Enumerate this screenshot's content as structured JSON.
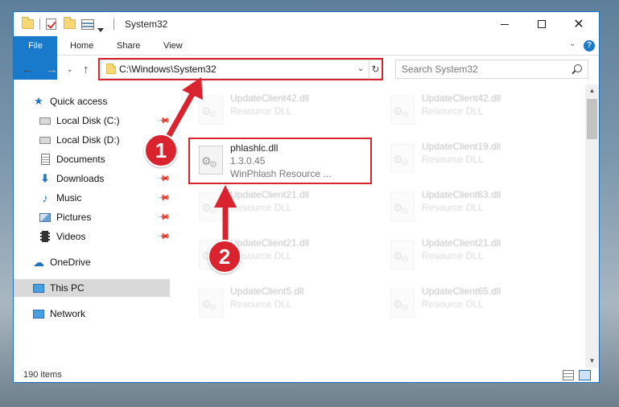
{
  "window": {
    "title": "System32"
  },
  "ribbon": {
    "tabs": [
      "File",
      "Home",
      "Share",
      "View"
    ]
  },
  "navigation": {
    "address_path": "C:\\Windows\\System32",
    "search_placeholder": "Search System32"
  },
  "sidebar": {
    "items": [
      {
        "label": "Quick access",
        "icon": "star-icon",
        "pinned": false
      },
      {
        "label": "Local Disk (C:)",
        "icon": "disk-icon",
        "pinned": true
      },
      {
        "label": "Local Disk (D:)",
        "icon": "disk-icon",
        "pinned": false
      },
      {
        "label": "Documents",
        "icon": "documents-icon",
        "pinned": false
      },
      {
        "label": "Downloads",
        "icon": "downloads-icon",
        "pinned": true
      },
      {
        "label": "Music",
        "icon": "music-icon",
        "pinned": true
      },
      {
        "label": "Pictures",
        "icon": "pictures-icon",
        "pinned": true
      },
      {
        "label": "Videos",
        "icon": "videos-icon",
        "pinned": true
      },
      {
        "label": "OneDrive",
        "icon": "onedrive-icon",
        "pinned": false
      },
      {
        "label": "This PC",
        "icon": "this-pc-icon",
        "pinned": false,
        "selected": true
      },
      {
        "label": "Network",
        "icon": "network-icon",
        "pinned": false
      }
    ]
  },
  "files": {
    "left": [
      {
        "name": "UpdateClient42.dll",
        "desc": "Resource DLL"
      },
      {
        "name": "phlashlc.dll",
        "version": "1.3.0.45",
        "desc": "WinPhlash Resource ..."
      },
      {
        "name": "UpdateClient21.dll",
        "desc": "Resource DLL"
      },
      {
        "name": "UpdateClient21.dll",
        "desc": "Resource DLL"
      },
      {
        "name": "UpdateClient5.dll",
        "desc": "Resource DLL"
      }
    ],
    "right": [
      {
        "name": "UpdateClient42.dll",
        "desc": "Resource DLL"
      },
      {
        "name": "UpdateClient19.dll",
        "desc": "Resource DLL"
      },
      {
        "name": "UpdateClient63.dll",
        "desc": "Resource DLL"
      },
      {
        "name": "UpdateClient21.dll",
        "desc": "Resource DLL"
      },
      {
        "name": "UpdateClient65.dll",
        "desc": "Resource DLL"
      }
    ]
  },
  "status": {
    "item_count": "190 items"
  },
  "annotations": {
    "step1": "1",
    "step2": "2",
    "color": "#d9232f"
  }
}
